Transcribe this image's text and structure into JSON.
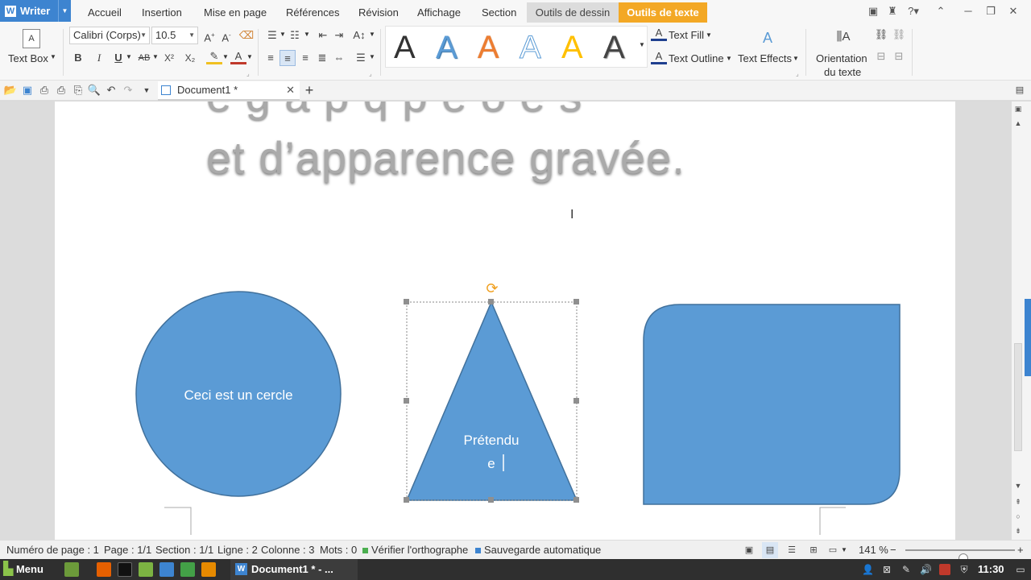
{
  "app": {
    "name": "Writer"
  },
  "menu": {
    "items": [
      "Accueil",
      "Insertion",
      "Mise en page",
      "Références",
      "Révision",
      "Affichage",
      "Section"
    ],
    "context_tabs": {
      "drawing": "Outils de dessin",
      "text": "Outils de texte"
    }
  },
  "ribbon": {
    "text_box_label": "Text Box",
    "font_name": "Calibri (Corps)",
    "font_size": "10.5",
    "text_fill": "Text Fill",
    "text_outline": "Text Outline",
    "text_effects": "Text Effects",
    "orientation_line1": "Orientation",
    "orientation_line2": "du texte",
    "bold": "B",
    "italic": "I",
    "underline": "U",
    "strike": "AB",
    "superscript": "X²",
    "subscript": "X₂",
    "style_glyph": "A"
  },
  "tabs": {
    "document": "Document1 *"
  },
  "document": {
    "heading_partial": "e  g  a  p  q  p  e  o  e  s",
    "heading": "et d’apparence gravée.",
    "circle_text": "Ceci est un cercle",
    "triangle_line1": "Prétendu",
    "triangle_line2": "e"
  },
  "status": {
    "page_number": "Numéro de page : 1",
    "page": "Page : 1/1",
    "section": "Section : 1/1",
    "line": "Ligne : 2",
    "column": "Colonne : 3",
    "words": "Mots : 0",
    "spell": "Vérifier l'orthographe",
    "autosave": "Sauvegarde automatique",
    "zoom": "141 %",
    "zoom_fraction": 0.53
  },
  "taskbar": {
    "menu": "Menu",
    "active_window": "Document1 * - ...",
    "time": "11:30"
  },
  "colors": {
    "accent": "#3d84d0",
    "text_tools_tab": "#f3a825",
    "shape_fill": "#5b9bd5",
    "shape_stroke": "#41719c"
  }
}
